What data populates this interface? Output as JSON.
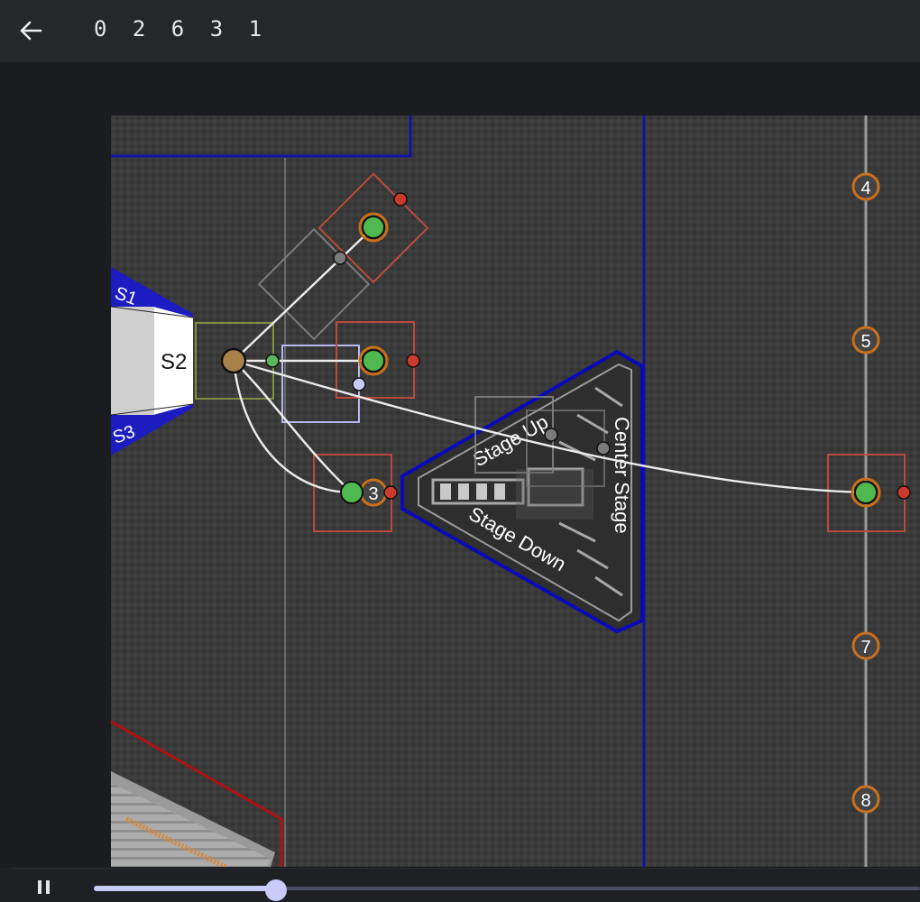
{
  "header": {
    "title": "0 2 6 3 1",
    "back_icon": "arrow-left-icon"
  },
  "field": {
    "zones": {
      "s1": "S1",
      "s2": "S2",
      "s3": "S3"
    },
    "stage_labels": {
      "stage_up": "Stage Up",
      "center_stage": "Center Stage",
      "stage_down": "Stage Down"
    },
    "markers": [
      "4",
      "5",
      "3",
      "7",
      "8"
    ]
  },
  "playback": {
    "play_state": "pause-icon",
    "progress": 0.22
  },
  "colors": {
    "accent": "#c9cbfb",
    "robot_green": "#4fb84f",
    "robot_red": "#cc3a2e",
    "alliance_blue": "#1414a8",
    "alliance_red": "#b01010",
    "marker_orange": "#c9701c"
  }
}
